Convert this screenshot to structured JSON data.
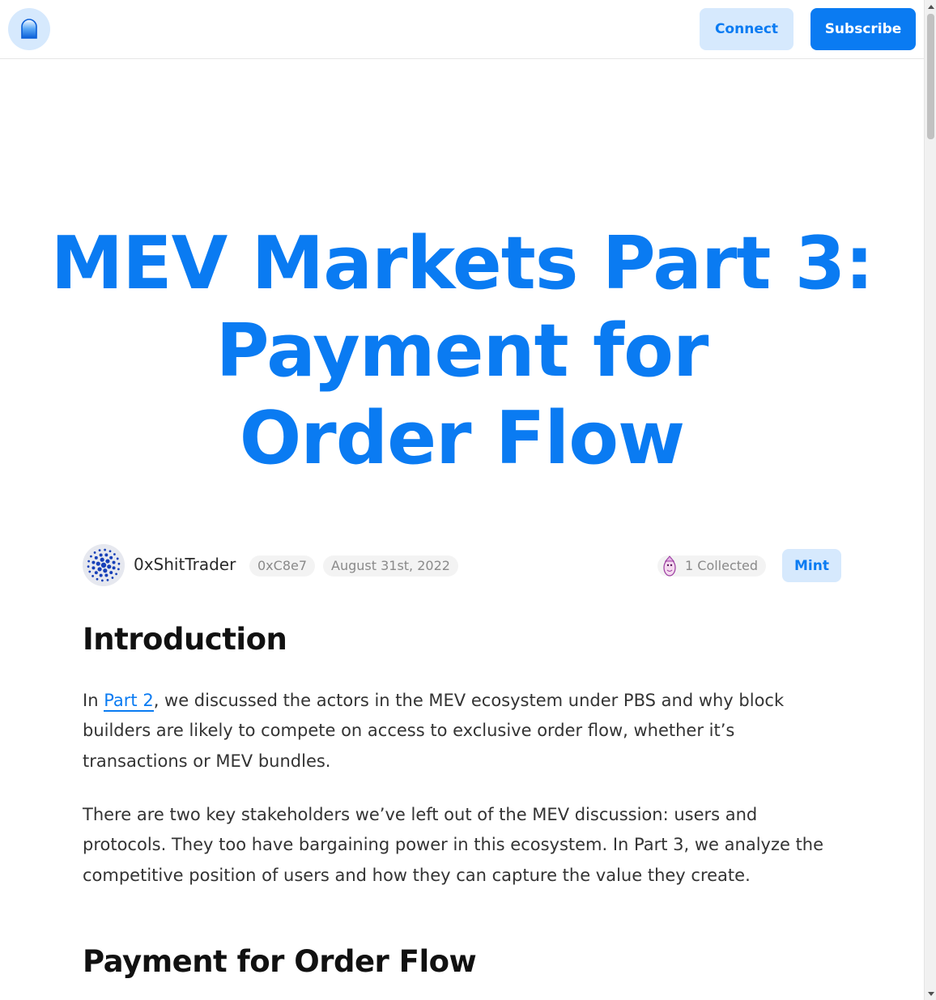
{
  "header": {
    "logo_icon": "mirror-logo-icon",
    "connect_label": "Connect",
    "subscribe_label": "Subscribe"
  },
  "post": {
    "title_lines": [
      "MEV Markets Part 3:",
      "Payment for",
      "Order Flow"
    ],
    "author": {
      "name": "0xShitTrader",
      "address": "0xC8e7",
      "avatar_icon": "dotted-circle-avatar-icon"
    },
    "date": "August 31st, 2022",
    "collected_label": "1 Collected",
    "mint_label": "Mint"
  },
  "article": {
    "intro_heading": "Introduction",
    "para1_prefix": "In ",
    "para1_link": "Part 2",
    "para1_suffix": ", we discussed the actors in the MEV ecosystem under PBS and why block builders are likely to compete on access to exclusive order flow, whether it’s transactions or MEV bundles.",
    "para2": "There are two key stakeholders we’ve left out of the MEV discussion: users and protocols. They too have bargaining power in this ecosystem. In Part 3, we analyze the competitive position of users and how they can capture the value they create.",
    "pfof_heading": "Payment for Order Flow"
  },
  "colors": {
    "accent": "#0a7bf2",
    "accent_light": "#d6e9fd",
    "pill_bg": "#f3f3f3",
    "muted_text": "#8a8a8a"
  }
}
